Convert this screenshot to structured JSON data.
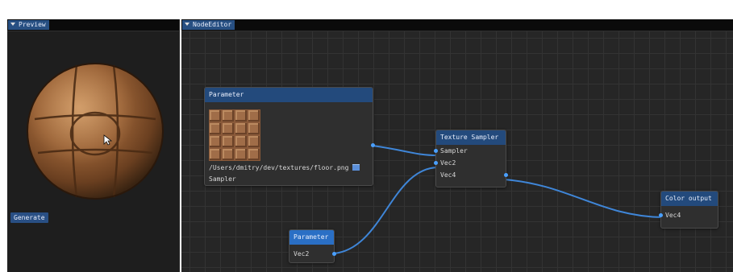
{
  "preview": {
    "title": "Preview",
    "generate_label": "Generate"
  },
  "editor": {
    "title": "NodeEditor",
    "nodes": {
      "parameter_texture": {
        "title": "Parameter",
        "path": "/Users/dmitry/dev/textures/floor.png",
        "output": "Sampler"
      },
      "texture_sampler": {
        "title": "Texture Sampler",
        "inputs": [
          "Sampler",
          "Vec2"
        ],
        "output": "Vec4"
      },
      "color_output": {
        "title": "Color output",
        "input": "Vec4"
      },
      "parameter_vec2": {
        "title": "Parameter",
        "output": "Vec2"
      }
    }
  },
  "colors": {
    "wire": "#3f86d8",
    "node_header": "#234a7c",
    "selected_node_header": "#2a6fc5",
    "tab": "#274f82"
  },
  "icons": [
    "collapse-triangle-icon",
    "folder-icon",
    "mouse-cursor-icon"
  ]
}
